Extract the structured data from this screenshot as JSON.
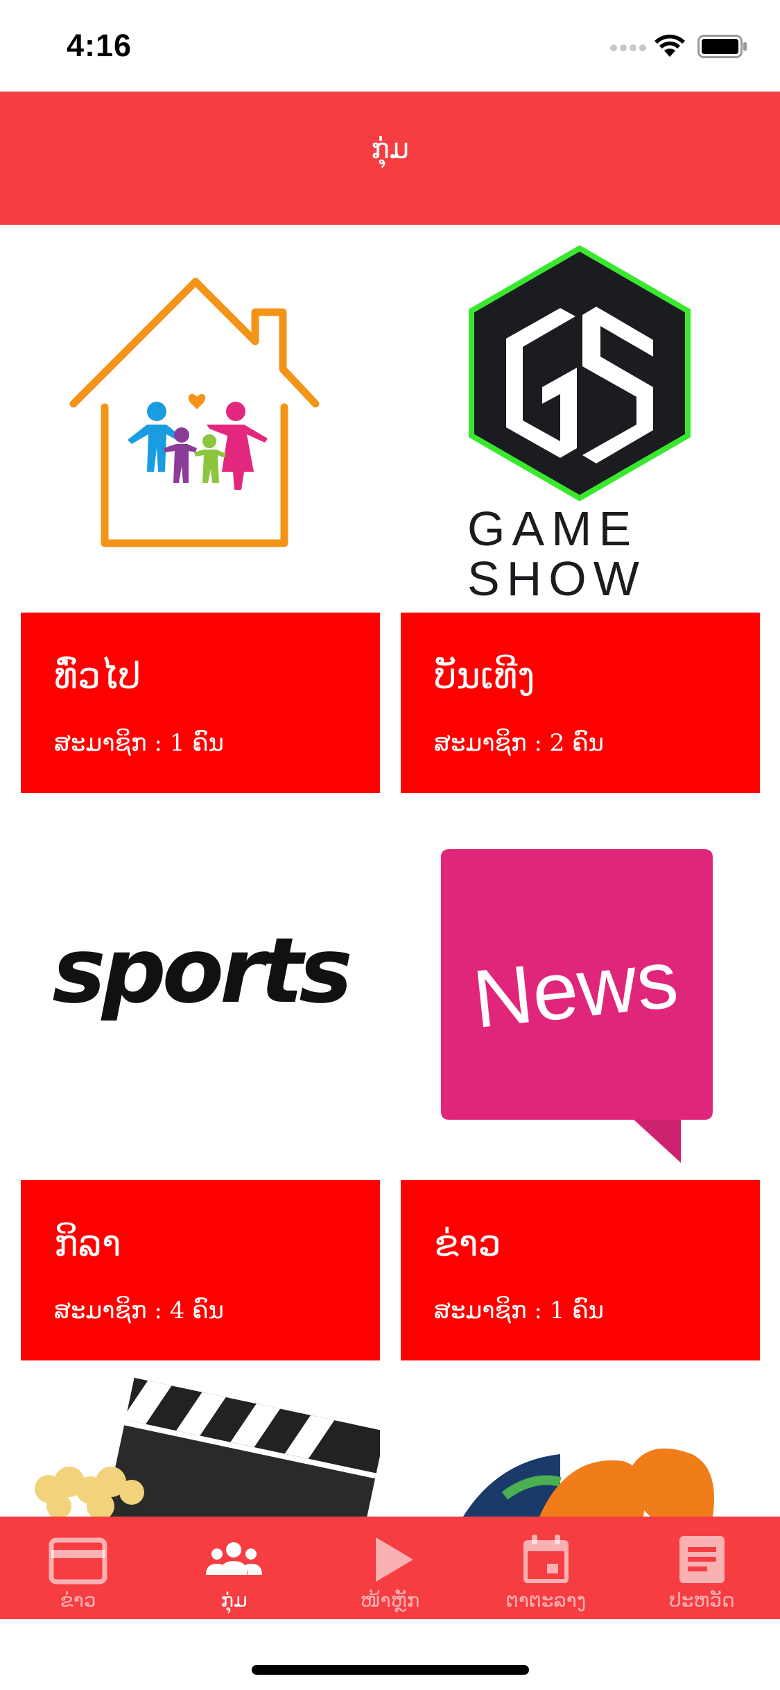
{
  "status_bar": {
    "time": "4:16"
  },
  "header": {
    "title": "ກຸ່ມ"
  },
  "groups": [
    {
      "name": "ທົ່ວໄປ",
      "members": "ສະມາຊິກ : 1 ຄົນ",
      "image": "family-house-logo"
    },
    {
      "name": "ບັນເທີງ",
      "members": "ສະມາຊິກ : 2 ຄົນ",
      "image": "game-show-logo",
      "logo_text_1": "GAME",
      "logo_text_2": "SHOW"
    },
    {
      "name": "ກິລາ",
      "members": "ສະມາຊິກ : 4 ຄົນ",
      "image": "sports-logo",
      "logo_text": "sports"
    },
    {
      "name": "ຂ່າວ",
      "members": "ສະມາຊິກ : 1 ຄົນ",
      "image": "news-bubble-logo",
      "logo_text": "News"
    }
  ],
  "tab_bar": {
    "items": [
      {
        "label": "ຂ່າວ",
        "icon": "card-icon",
        "active": false
      },
      {
        "label": "ກຸ່ມ",
        "icon": "group-icon",
        "active": true
      },
      {
        "label": "ໜ້າຫຼັກ",
        "icon": "play-icon",
        "active": false
      },
      {
        "label": "ຕາຕະລາງ",
        "icon": "calendar-icon",
        "active": false
      },
      {
        "label": "ປະຫວັດ",
        "icon": "document-icon",
        "active": false
      }
    ]
  },
  "colors": {
    "header": "#f53d42",
    "card_panel": "#ff0000",
    "news_pink": "#e0267a",
    "house_orange": "#f39419",
    "gs_green": "#39e82e"
  }
}
